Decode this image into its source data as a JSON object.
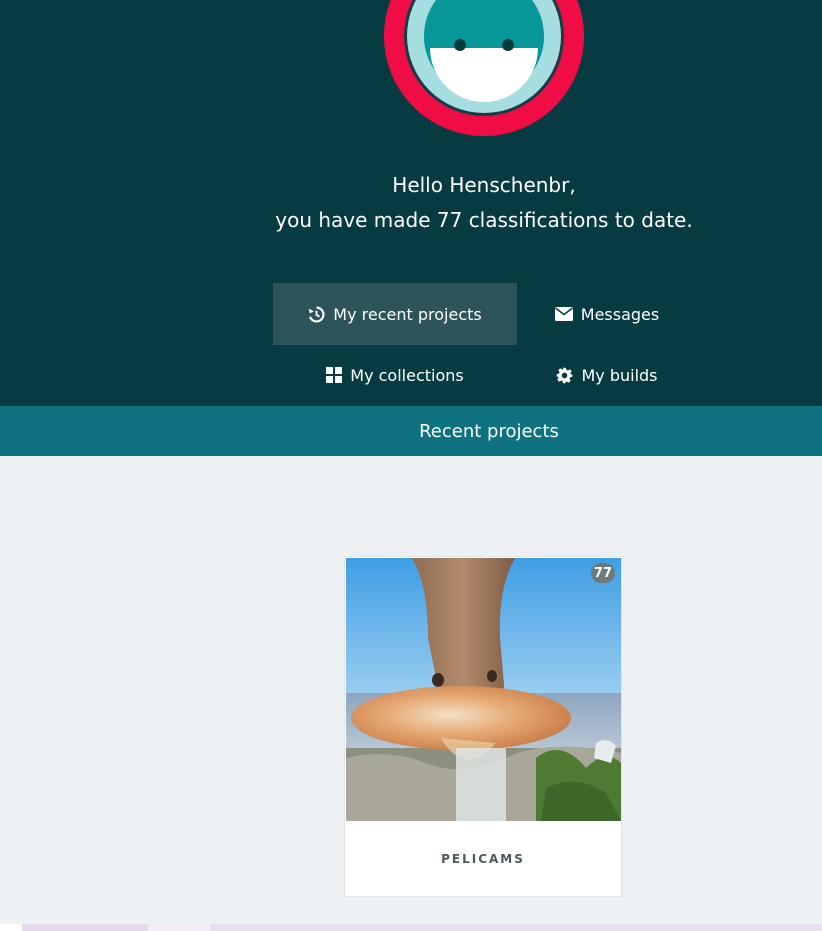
{
  "profile": {
    "greeting_line1": "Hello Henschenbr,",
    "greeting_line2": "you have made 77 classifications to date.",
    "avatar_icon": "zooniverse-smiley-avatar"
  },
  "nav": {
    "recent_projects": "My recent projects",
    "messages": "Messages",
    "collections": "My collections",
    "builds": "My builds",
    "icons": [
      "history-icon",
      "envelope-icon",
      "grid-icon",
      "gear-icon"
    ]
  },
  "section": {
    "title": "Recent projects"
  },
  "projects": [
    {
      "name": "PELICAMS",
      "classifications": "77"
    }
  ],
  "colors": {
    "hero_bg": "#073b42",
    "section_bar": "#0e7281",
    "avatar_ring": "#f00d46",
    "active_tab": "#2d5458"
  }
}
